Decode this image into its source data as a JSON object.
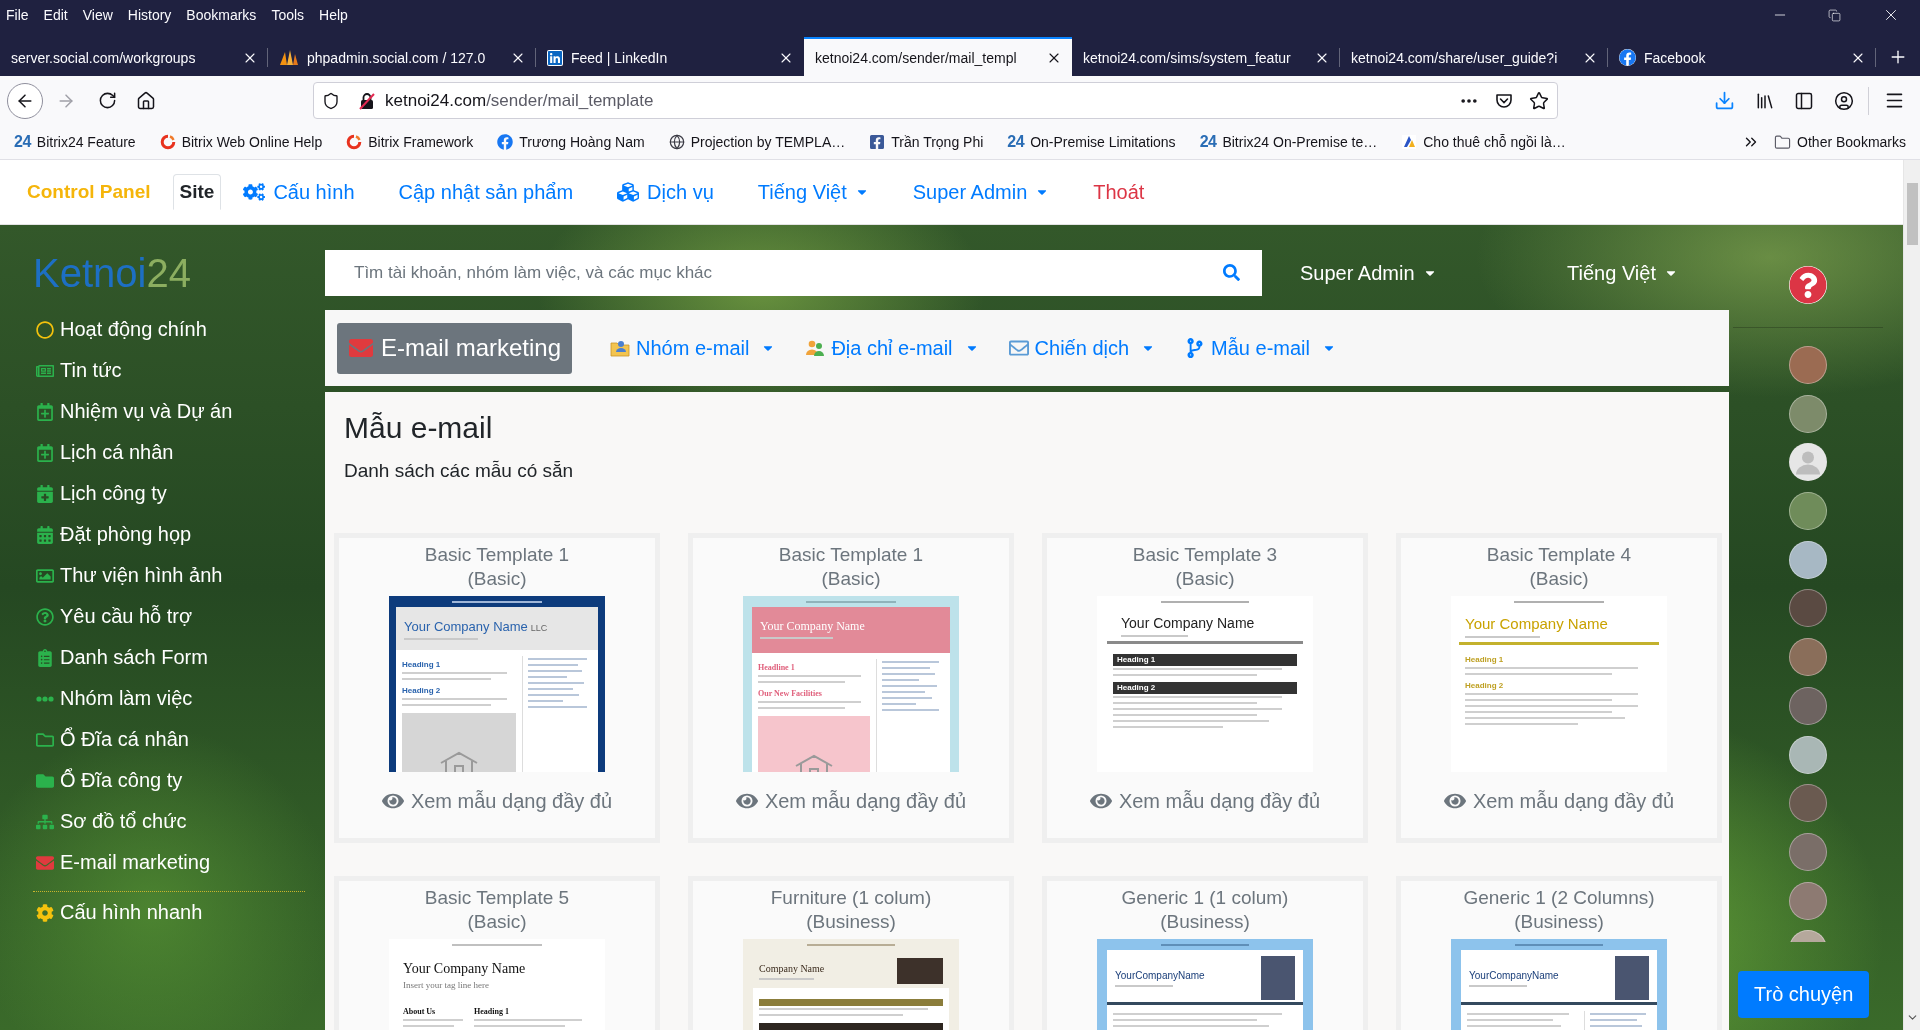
{
  "menu_bar": [
    "File",
    "Edit",
    "View",
    "History",
    "Bookmarks",
    "Tools",
    "Help"
  ],
  "tabs": [
    {
      "title": "server.social.com/workgroups",
      "kind": "plain",
      "selected": false
    },
    {
      "title": "phpadmin.social.com / 127.0",
      "kind": "sails",
      "selected": false
    },
    {
      "title": "Feed | LinkedIn",
      "kind": "linkedin",
      "selected": false
    },
    {
      "title": "ketnoi24.com/sender/mail_templ",
      "kind": "plain",
      "selected": true
    },
    {
      "title": "ketnoi24.com/sims/system_featur",
      "kind": "plain",
      "selected": false
    },
    {
      "title": "ketnoi24.com/share/user_guide?i",
      "kind": "plain",
      "selected": false
    },
    {
      "title": "Facebook",
      "kind": "facebook",
      "selected": false
    }
  ],
  "address_bar": {
    "host": "ketnoi24.com",
    "path": "/sender/mail_template"
  },
  "bookmarks": [
    {
      "label": "Bitrix24 Feature",
      "kind": "bitrix24",
      "logo": "24"
    },
    {
      "label": "Bitrix Web Online Help",
      "kind": "ring"
    },
    {
      "label": "Bitrix Framework",
      "kind": "ring"
    },
    {
      "label": "Trương Hoàng Nam",
      "kind": "facebook"
    },
    {
      "label": "Projection by TEMPLA…",
      "kind": "web"
    },
    {
      "label": "Trần Trọng Phi",
      "kind": "facebook-page"
    },
    {
      "label": "On-Premise Limitations",
      "kind": "bitrix24",
      "logo": "24"
    },
    {
      "label": "Bitrix24 On-Premise te…",
      "kind": "bitrix24",
      "logo": "24"
    },
    {
      "label": "Cho thuê chỗ ngồi là…",
      "kind": "site"
    }
  ],
  "other_bookmarks": "Other Bookmarks",
  "control_bar": {
    "brand": "Control Panel",
    "items": [
      {
        "label": "Site",
        "kind": "link",
        "selected": true
      },
      {
        "label": "Cấu hình",
        "kind": "link",
        "selected": false
      },
      {
        "label": "Cập nhật sản phẩm",
        "kind": "link",
        "selected": false
      },
      {
        "label": "Dịch vụ",
        "kind": "link",
        "selected": false
      },
      {
        "label": "Tiếng Việt",
        "kind": "dropdown",
        "selected": false
      },
      {
        "label": "Super Admin",
        "kind": "dropdown",
        "selected": false
      },
      {
        "label": "Thoát",
        "kind": "danger",
        "selected": false
      }
    ]
  },
  "logo": {
    "text": "Ketnoi",
    "accent": "24"
  },
  "sidebar": {
    "items": [
      "Hoạt động chính",
      "Tin tức",
      "Nhiệm vụ và Dự án",
      "Lịch cá nhân",
      "Lịch công ty",
      "Đặt phòng họp",
      "Thư viện hình ảnh",
      "Yêu cầu hỗ trợ",
      "Danh sách Form",
      "Nhóm làm việc",
      "Ổ Đĩa cá nhân",
      "Ổ Đĩa công ty",
      "Sơ đồ tổ chức",
      "E-mail marketing"
    ],
    "footer": "Cấu hình nhanh"
  },
  "search": {
    "placeholder": "Tìm tài khoản, nhóm làm việc, và các mục khác"
  },
  "header_menus": [
    "Super Admin",
    "Tiếng Việt"
  ],
  "subnav": {
    "title": "E-mail marketing",
    "menus": [
      "Nhóm e-mail",
      "Địa chỉ e-mail",
      "Chiến dịch",
      "Mẫu e-mail"
    ]
  },
  "page": {
    "title": "Mẫu e-mail",
    "subtitle": "Danh sách các mẫu có sẵn"
  },
  "templates": [
    {
      "name": "Basic Template 1",
      "category": "(Basic)",
      "link": "Xem mẫu dạng đầy đủ",
      "preview": {
        "kind": "framed",
        "company": "Your Company Name",
        "suffix": "LLC",
        "headings": [
          "Heading 1",
          "Heading 2"
        ]
      }
    },
    {
      "name": "Basic Template 1",
      "category": "(Basic)",
      "link": "Xem mẫu dạng đầy đủ",
      "preview": {
        "kind": "pink",
        "company": "Your Company Name",
        "headings": [
          "Headline 1",
          "Our New Facilities"
        ]
      }
    },
    {
      "name": "Basic Template 3",
      "category": "(Basic)",
      "link": "Xem mẫu dạng đầy đủ",
      "preview": {
        "kind": "banded",
        "company": "Your Company Name",
        "headings": [
          "Heading 1",
          "Heading 2"
        ]
      }
    },
    {
      "name": "Basic Template 4",
      "category": "(Basic)",
      "link": "Xem mẫu dạng đầy đủ",
      "preview": {
        "kind": "gold",
        "company": "Your Company Name",
        "headings": [
          "Heading 1",
          "Heading 2"
        ]
      }
    },
    {
      "name": "Basic Template 5",
      "category": "(Basic)",
      "preview": {
        "kind": "classic",
        "company": "Your Company Name",
        "tagline": "Insert your tag line here",
        "headings": [
          "About Us",
          "Heading 1"
        ]
      }
    },
    {
      "name": "Furniture (1 colum)",
      "category": "(Business)",
      "preview": {
        "kind": "furniture",
        "company": "Company Name"
      }
    },
    {
      "name": "Generic 1 (1 colum)",
      "category": "(Business)",
      "preview": {
        "kind": "generic",
        "company": "YourCompanyName"
      }
    },
    {
      "name": "Generic 1 (2 Columns)",
      "category": "(Business)",
      "preview": {
        "kind": "generic-2col",
        "company": "YourCompanyName"
      }
    }
  ],
  "contacts": [
    {
      "kind": "photo"
    },
    {
      "kind": "photo"
    },
    {
      "kind": "silhouette"
    },
    {
      "kind": "photo"
    },
    {
      "kind": "photo"
    },
    {
      "kind": "photo"
    },
    {
      "kind": "photo"
    },
    {
      "kind": "photo"
    },
    {
      "kind": "photo"
    },
    {
      "kind": "photo"
    },
    {
      "kind": "photo"
    },
    {
      "kind": "photo"
    },
    {
      "kind": "photo"
    }
  ],
  "chat_button": "Trò chuyện"
}
